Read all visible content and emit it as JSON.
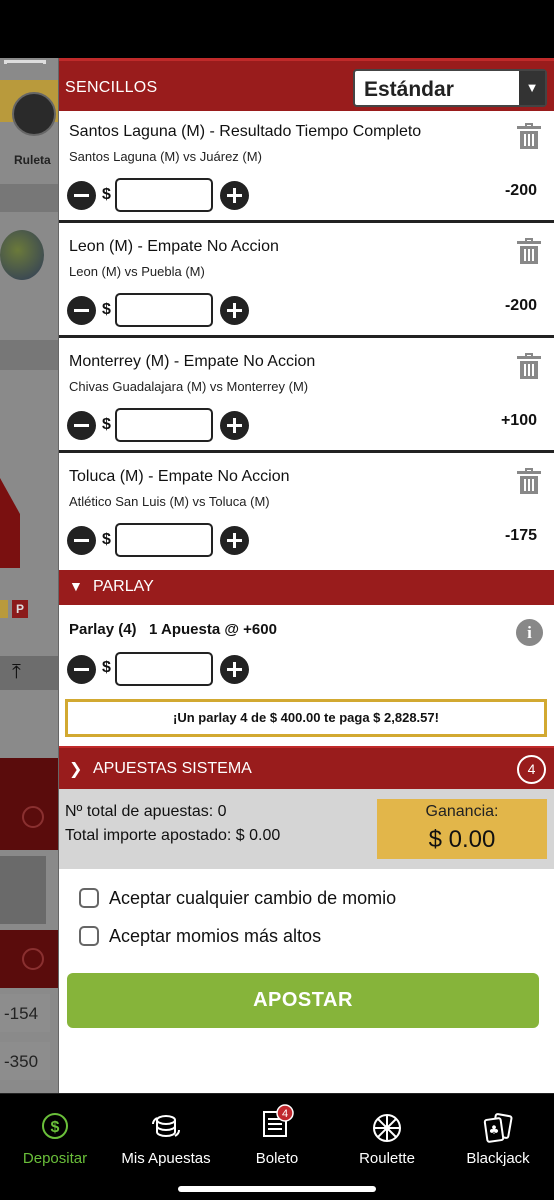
{
  "background": {
    "ruleta_label": "Ruleta",
    "p_badge": "P",
    "odds": [
      "-154",
      "-350"
    ]
  },
  "betslip": {
    "section_label": "SENCILLOS",
    "mode_select": {
      "value": "Estándar"
    },
    "currency": "$",
    "bets": [
      {
        "title": "Santos Laguna (M) - Resultado Tiempo Completo",
        "match": "Santos Laguna (M) vs Juárez (M)",
        "odds": "-200",
        "stake": ""
      },
      {
        "title": "Leon (M) - Empate No Accion",
        "match": "Leon (M) vs Puebla (M)",
        "odds": "-200",
        "stake": ""
      },
      {
        "title": "Monterrey (M) - Empate No Accion",
        "match": "Chivas Guadalajara (M) vs Monterrey (M)",
        "odds": "+100",
        "stake": ""
      },
      {
        "title": "Toluca (M) - Empate No Accion",
        "match": "Atlético San Luis (M) vs Toluca (M)",
        "odds": "-175",
        "stake": ""
      }
    ],
    "parlay": {
      "header": "PARLAY",
      "title": "Parlay (4)   1 Apuesta @ +600",
      "stake": "",
      "promo": "¡Un parlay 4 de $ 400.00 te paga $ 2,828.57!"
    },
    "system": {
      "header": "APUESTAS SISTEMA",
      "count": "4"
    },
    "summary": {
      "total_bets": "Nº total de apuestas: 0",
      "total_amount": "Total importe apostado: $ 0.00",
      "gain_label": "Ganancia:",
      "gain_value": "$ 0.00"
    },
    "options": {
      "accept_any": "Aceptar cualquier cambio de momio",
      "accept_higher": "Aceptar momios más altos",
      "accept_any_checked": false,
      "accept_higher_checked": false
    },
    "submit_label": "APOSTAR"
  },
  "nav": {
    "items": [
      {
        "label": "Depositar",
        "icon": "dollar-icon",
        "active": true
      },
      {
        "label": "Mis Apuestas",
        "icon": "coins-icon",
        "active": false
      },
      {
        "label": "Boleto",
        "icon": "ticket-icon",
        "active": false,
        "badge": "4"
      },
      {
        "label": "Roulette",
        "icon": "roulette-icon",
        "active": false
      },
      {
        "label": "Blackjack",
        "icon": "cards-icon",
        "active": false
      }
    ]
  },
  "colors": {
    "header_red": "#991c1c",
    "accent_green": "#86b43a",
    "gold": "#e2b64a",
    "active_nav": "#6abf3a"
  }
}
